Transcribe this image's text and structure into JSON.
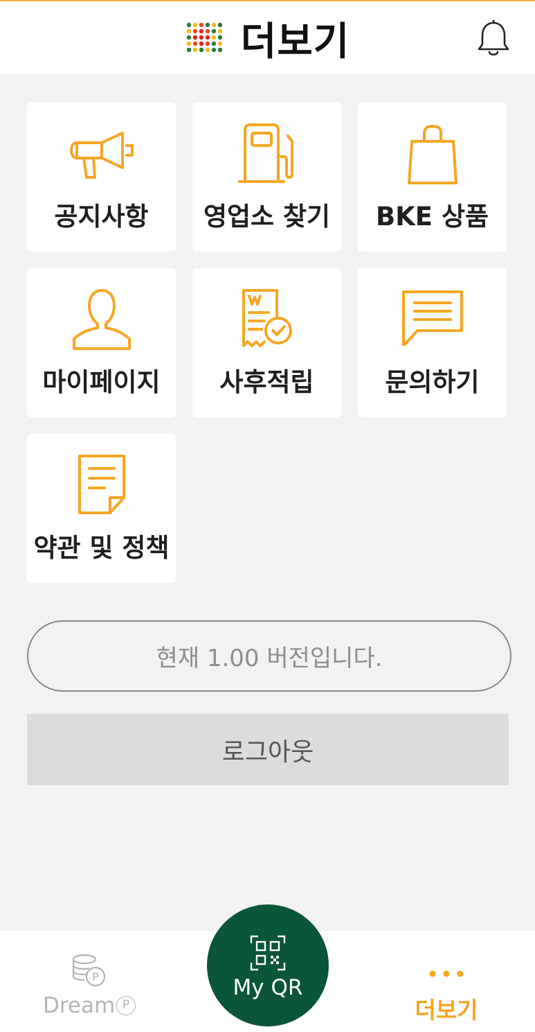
{
  "header": {
    "title": "더보기",
    "logo_icon": "dot-grid-logo",
    "bell_icon": "bell-icon"
  },
  "tiles": [
    {
      "label": "공지사항",
      "icon": "megaphone-icon"
    },
    {
      "label": "영업소 찾기",
      "icon": "gas-pump-icon"
    },
    {
      "label": "BKE 상품",
      "icon": "shopping-bag-icon"
    },
    {
      "label": "마이페이지",
      "icon": "person-icon"
    },
    {
      "label": "사후적립",
      "icon": "receipt-check-icon"
    },
    {
      "label": "문의하기",
      "icon": "chat-bubble-icon"
    },
    {
      "label": "약관 및 정책",
      "icon": "document-icon"
    }
  ],
  "version_text": "현재 1.00 버전입니다.",
  "logout_label": "로그아웃",
  "bottom_nav": {
    "dream_label": "Dream",
    "dream_badge": "P",
    "qr_label": "My QR",
    "more_label": "더보기",
    "more_dots": "• • •"
  },
  "colors": {
    "accent": "#f5a623",
    "brand_green": "#0b5538",
    "background": "#f2f2f2"
  }
}
